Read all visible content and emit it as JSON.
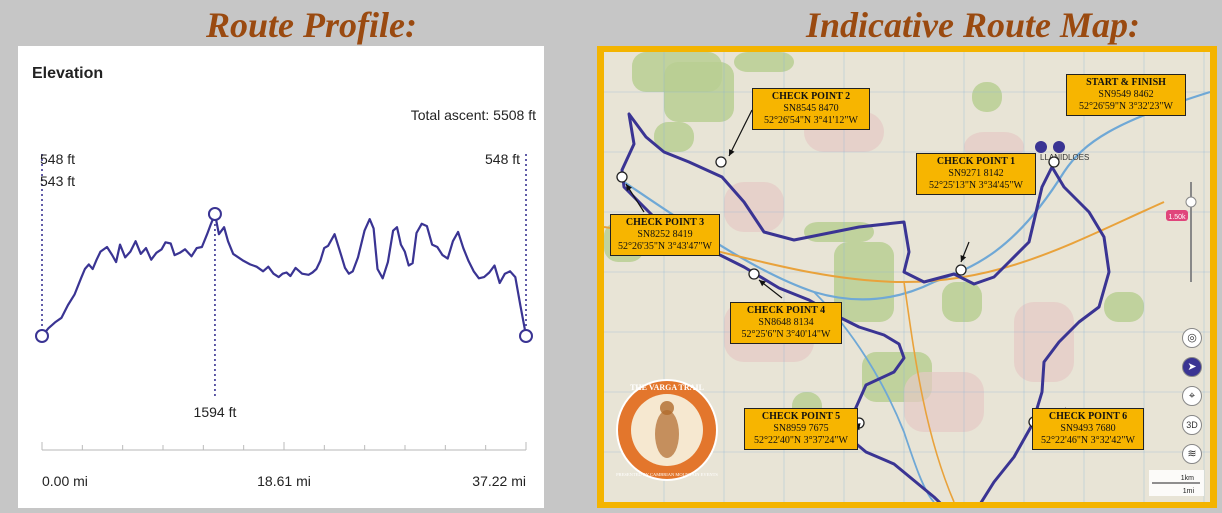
{
  "headings": {
    "profile": "Route Profile:",
    "map": "Indicative Route Map:"
  },
  "chart_data": {
    "type": "area",
    "title": "Elevation",
    "total_ascent": "Total ascent: 5508 ft",
    "x_unit": "mi",
    "x_ticks": [
      "0.00 mi",
      "18.61 mi",
      "37.22 mi"
    ],
    "annotations": {
      "start_upper": "548 ft",
      "start_lower": "543 ft",
      "end": "548 ft",
      "max": "1594 ft"
    },
    "max_point": {
      "x": 13.3,
      "y": 1594
    },
    "series": [
      {
        "x": [
          0,
          0.5,
          1,
          1.5,
          2,
          2.5,
          3,
          3.3,
          3.6,
          3.9,
          4.2,
          4.5,
          5.0,
          5.4,
          5.7,
          6.0,
          6.4,
          6.8,
          7.2,
          7.6,
          8.0,
          8.4,
          8.8,
          9.2,
          9.5,
          9.9,
          10.2,
          10.6,
          11.0,
          11.5,
          11.9,
          12.3,
          12.7,
          13.0,
          13.3,
          13.6,
          14.0,
          14.3,
          14.7,
          15.1,
          15.5,
          16.0,
          16.5,
          17.0,
          17.4,
          17.8,
          18.2,
          18.5,
          18.8,
          19.1,
          19.5,
          20.0,
          20.5,
          20.8,
          21.1,
          21.4,
          21.7,
          22.0,
          22.5,
          23.0,
          23.3,
          23.6,
          23.9,
          24.3,
          24.8,
          25.2,
          25.5,
          25.8,
          26.2,
          26.6,
          27.0,
          27.3,
          27.6,
          27.9,
          28.2,
          28.5,
          28.8,
          29.2,
          29.6,
          30.0,
          30.4,
          30.8,
          31.2,
          31.6,
          32.0,
          32.4,
          32.8,
          33.2,
          33.6,
          34.0,
          34.4,
          34.8,
          35.2,
          35.6,
          36.0,
          36.4,
          36.8,
          37.22
        ],
        "y": [
          543,
          610,
          660,
          700,
          810,
          900,
          1040,
          1120,
          1160,
          1120,
          1200,
          1270,
          1310,
          1240,
          1180,
          1330,
          1220,
          1270,
          1360,
          1250,
          1300,
          1200,
          1260,
          1290,
          1350,
          1340,
          1240,
          1260,
          1290,
          1230,
          1300,
          1310,
          1420,
          1510,
          1594,
          1420,
          1480,
          1360,
          1250,
          1220,
          1190,
          1160,
          1140,
          1100,
          1140,
          1080,
          1050,
          1080,
          1090,
          1060,
          1130,
          1080,
          1070,
          1090,
          1120,
          1190,
          1300,
          1320,
          1420,
          1240,
          1130,
          1080,
          1100,
          1220,
          1450,
          1550,
          1470,
          1120,
          1040,
          1180,
          1450,
          1480,
          1330,
          1270,
          1150,
          1170,
          1430,
          1510,
          1490,
          1330,
          1310,
          1240,
          1210,
          1360,
          1440,
          1300,
          1190,
          1100,
          1040,
          1050,
          1090,
          1150,
          1000,
          1080,
          1100,
          1050,
          800,
          548
        ]
      }
    ]
  },
  "map": {
    "start_finish": {
      "title": "START & FINISH",
      "grid": "SN9549 8462",
      "coords": "52°26'59\"N 3°32'23\"W"
    },
    "checkpoints": [
      {
        "title": "CHECK POINT 1",
        "grid": "SN9271 8142",
        "coords": "52°25'13\"N 3°34'45\"W"
      },
      {
        "title": "CHECK POINT 2",
        "grid": "SN8545 8470",
        "coords": "52°26'54\"N 3°41'12\"W"
      },
      {
        "title": "CHECK POINT 3",
        "grid": "SN8252 8419",
        "coords": "52°26'35\"N 3°43'47\"W"
      },
      {
        "title": "CHECK POINT 4",
        "grid": "SN8648 8134",
        "coords": "52°25'6\"N 3°40'14\"W"
      },
      {
        "title": "CHECK POINT 5",
        "grid": "SN8959 7675",
        "coords": "52°22'40\"N 3°37'24\"W"
      },
      {
        "title": "CHECK POINT 6",
        "grid": "SN9493 7680",
        "coords": "52°22'46\"N 3°32'42\"W"
      }
    ],
    "badge": {
      "title": "THE VARGA TRAIL",
      "subtitle": "PRESENTED BY CAMBRIAN MOUNTAIN EVENTS"
    },
    "town_label": "LLANIDLOES",
    "scale_km": "1km",
    "scale_mi": "1mi",
    "zoom_badge": "1.50k",
    "route_color": "#3a3493",
    "accent": "#f4b400",
    "heading_color": "#9a4a10"
  }
}
